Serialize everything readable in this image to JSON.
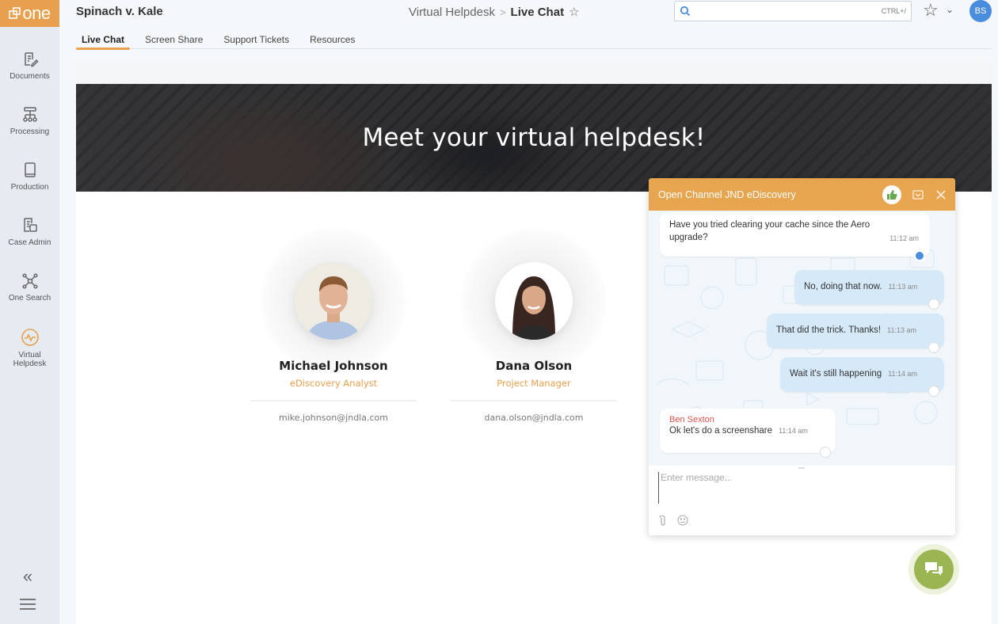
{
  "app": {
    "logo_text": "one",
    "brand_color": "#e8a04e"
  },
  "sidebar": {
    "items": [
      {
        "label": "Documents",
        "icon": "document-edit-icon"
      },
      {
        "label": "Processing",
        "icon": "processing-tree-icon"
      },
      {
        "label": "Production",
        "icon": "book-icon"
      },
      {
        "label": "Case Admin",
        "icon": "case-admin-icon"
      },
      {
        "label": "One Search",
        "icon": "network-icon"
      },
      {
        "label": "Virtual Helpdesk",
        "icon": "pulse-icon",
        "active": true
      }
    ],
    "collapse_label": "«"
  },
  "header": {
    "case_title": "Spinach v. Kale",
    "breadcrumb": {
      "parent": "Virtual Helpdesk",
      "separator": ">",
      "current": "Live Chat"
    },
    "search": {
      "value": "",
      "placeholder": "",
      "shortcut": "CTRL+/"
    },
    "user_initials": "BS"
  },
  "tabs": [
    {
      "label": "Live Chat",
      "active": true
    },
    {
      "label": "Screen Share"
    },
    {
      "label": "Support Tickets"
    },
    {
      "label": "Resources"
    }
  ],
  "hero": {
    "title": "Meet your virtual helpdesk!"
  },
  "people": [
    {
      "name": "Michael Johnson",
      "role": "eDiscovery Analyst",
      "email": "mike.johnson@jndla.com"
    },
    {
      "name": "Dana Olson",
      "role": "Project Manager",
      "email": "dana.olson@jndla.com"
    }
  ],
  "chat": {
    "title": "Open Channel JND eDiscovery",
    "messages": [
      {
        "direction": "in",
        "text": "Have you tried clearing your cache since the Aero upgrade?",
        "time": "11:12 am"
      },
      {
        "direction": "out",
        "text": "No, doing that now.",
        "time": "11:13 am"
      },
      {
        "direction": "out",
        "text": "That did the trick. Thanks!",
        "time": "11:13 am"
      },
      {
        "direction": "out",
        "text": "Wait it's still happening",
        "time": "11:14 am"
      },
      {
        "direction": "in",
        "sender": "Ben Sexton",
        "text": "Ok let's do a screenshare",
        "time": "11:14 am"
      }
    ],
    "input": {
      "value": "",
      "placeholder": "Enter message..."
    },
    "header_color": "#e8a550",
    "fab_color": "#9bb553"
  }
}
